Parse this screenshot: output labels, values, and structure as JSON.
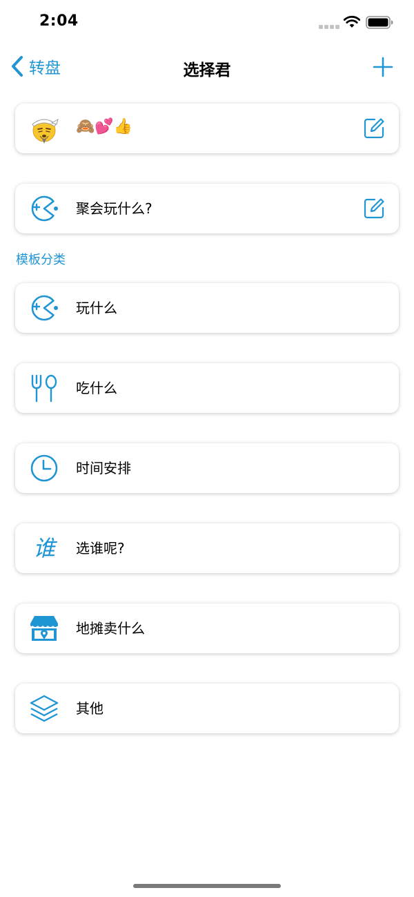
{
  "status_bar": {
    "time": "2:04"
  },
  "nav": {
    "back_label": "转盘",
    "title": "选择君"
  },
  "top_cards": [
    {
      "label": "🙈💕👍",
      "icon": "sage-face-icon"
    },
    {
      "label": "聚会玩什么?",
      "icon": "pacman-game-icon"
    }
  ],
  "section_header": "模板分类",
  "categories": [
    {
      "label": "玩什么",
      "icon": "pacman-game-icon"
    },
    {
      "label": "吃什么",
      "icon": "fork-spoon-icon"
    },
    {
      "label": "时间安排",
      "icon": "clock-icon"
    },
    {
      "label": "选谁呢?",
      "icon": "who-character-icon",
      "icon_text": "谁"
    },
    {
      "label": "地摊卖什么",
      "icon": "shop-stall-icon"
    },
    {
      "label": "其他",
      "icon": "layers-icon"
    }
  ],
  "colors": {
    "accent": "#1f95d4"
  }
}
